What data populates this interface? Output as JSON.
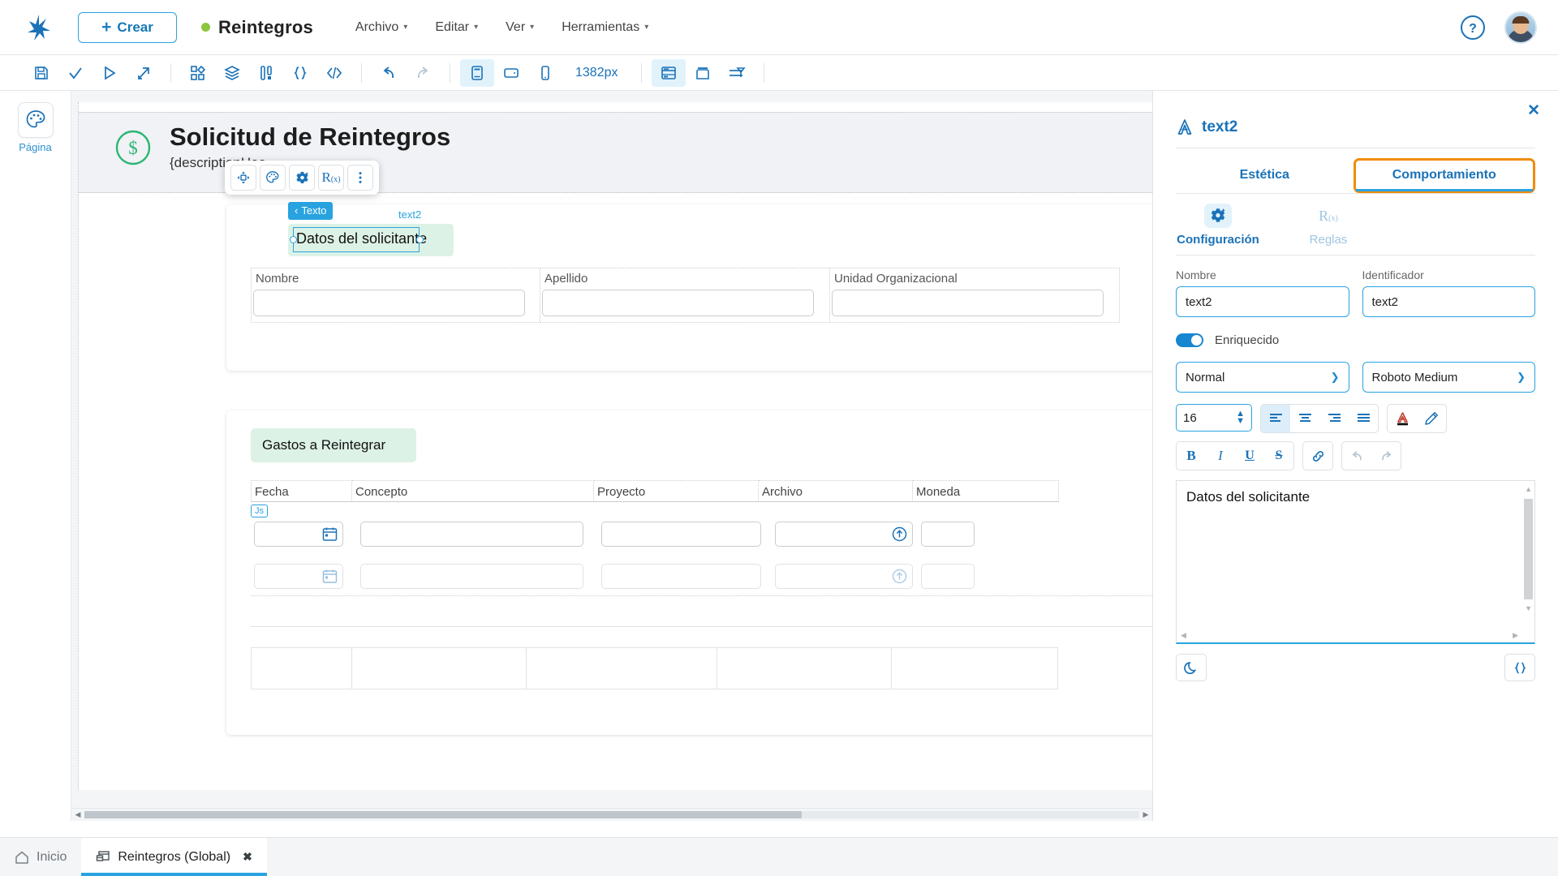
{
  "header": {
    "logo_icon": "bonita-logo-icon",
    "create_label": "Crear",
    "doc_title": "Reintegros",
    "status_dot_color": "#8cc63f",
    "menus": [
      {
        "label": "Archivo"
      },
      {
        "label": "Editar"
      },
      {
        "label": "Ver"
      },
      {
        "label": "Herramientas"
      }
    ],
    "help_icon": "help-circle-icon",
    "avatar": "user-avatar"
  },
  "toolbar": {
    "zoom_value": "1382px",
    "buttons": [
      {
        "name": "save-icon"
      },
      {
        "name": "validate-check-icon"
      },
      {
        "name": "run-play-icon"
      },
      {
        "name": "export-arrow-icon"
      },
      {
        "name": "widgets-grid-icon"
      },
      {
        "name": "layers-stack-icon"
      },
      {
        "name": "variables-icon"
      },
      {
        "name": "expression-braces-icon"
      },
      {
        "name": "code-angle-brackets-icon"
      },
      {
        "name": "undo-icon"
      },
      {
        "name": "redo-icon"
      },
      {
        "name": "desktop-preview-icon"
      },
      {
        "name": "tablet-preview-icon"
      },
      {
        "name": "mobile-preview-icon"
      },
      {
        "name": "form-container-icon"
      },
      {
        "name": "modal-container-icon"
      },
      {
        "name": "align-icon"
      }
    ]
  },
  "left_rail": {
    "items": [
      {
        "label": "Página",
        "icon": "palette-icon"
      }
    ]
  },
  "canvas": {
    "form_header": {
      "icon": "dollar-circle-icon",
      "title": "Solicitud de Reintegros",
      "subtitle": "{descriptionHea"
    },
    "selection": {
      "chip_label": "Texto",
      "chip_arrow": "‹",
      "component_tag": "text2",
      "selected_text": "Datos del solicitante",
      "js_badge": "Js"
    },
    "float_toolbar": [
      {
        "name": "move-icon"
      },
      {
        "name": "palette-icon"
      },
      {
        "name": "settings-gear-icon"
      },
      {
        "name": "expression-rx-icon"
      },
      {
        "name": "more-vertical-icon"
      }
    ],
    "section1": {
      "fields": [
        {
          "label": "Nombre"
        },
        {
          "label": "Apellido"
        },
        {
          "label": "Unidad Organizacional"
        }
      ]
    },
    "section2": {
      "title": "Gastos a Reintegrar",
      "columns": [
        "Fecha",
        "Concepto",
        "Proyecto",
        "Archivo",
        "Moneda"
      ],
      "row_icons": {
        "date": "calendar-icon",
        "upload": "upload-circle-icon"
      }
    }
  },
  "panel": {
    "close_icon": "close-icon",
    "component_icon": "text-A-icon",
    "component_name": "text2",
    "tabs": [
      {
        "label": "Estética",
        "selected": false
      },
      {
        "label": "Comportamiento",
        "selected": true
      }
    ],
    "subtabs": [
      {
        "label": "Configuración",
        "icon": "settings-gear-icon",
        "selected": true
      },
      {
        "label": "Reglas",
        "icon": "expression-rx-icon",
        "selected": false
      }
    ],
    "fields": {
      "nombre_label": "Nombre",
      "nombre_value": "text2",
      "identificador_label": "Identificador",
      "identificador_value": "text2"
    },
    "toggle": {
      "label": "Enriquecido",
      "on": true
    },
    "selects": {
      "style_value": "Normal",
      "font_value": "Roboto Medium"
    },
    "rich_text": {
      "font_size": "16",
      "align_buttons": [
        "align-left-icon",
        "align-center-icon",
        "align-right-icon",
        "align-justify-icon"
      ],
      "color_buttons": [
        "font-color-icon",
        "highlight-pencil-icon"
      ],
      "format_buttons": [
        "bold-icon",
        "italic-icon",
        "underline-icon",
        "strikethrough-icon"
      ],
      "link_button": "link-icon",
      "history_buttons": [
        "undo-icon",
        "redo-icon"
      ],
      "editor_content": "Datos del solicitante",
      "footer_buttons": [
        "moon-dark-mode-icon",
        "braces-expression-icon"
      ]
    },
    "accent_color": "#29a3e0",
    "focus_outline_color": "#ef8c0b"
  },
  "bottom_tabs": [
    {
      "label": "Inicio",
      "icon": "home-icon",
      "active": false,
      "closable": false
    },
    {
      "label": "Reintegros (Global)",
      "icon": "page-icon",
      "active": true,
      "closable": true,
      "close_label": "✖"
    }
  ]
}
